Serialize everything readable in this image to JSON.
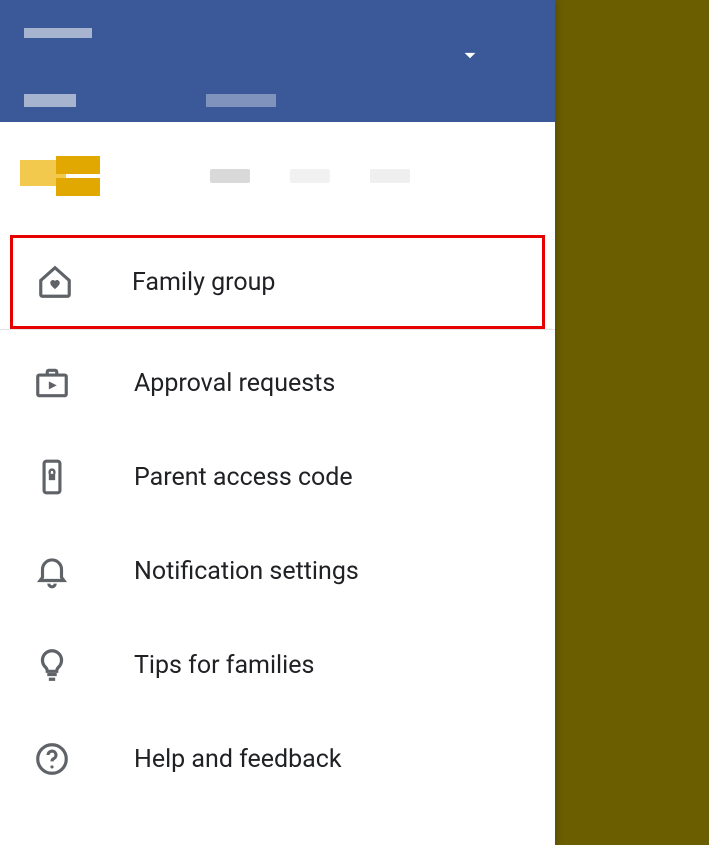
{
  "menu": {
    "family_group": "Family group",
    "approval_requests": "Approval requests",
    "parent_access_code": "Parent access code",
    "notification_settings": "Notification settings",
    "tips_for_families": "Tips for families",
    "help_and_feedback": "Help and feedback"
  },
  "highlighted_item": "family_group"
}
